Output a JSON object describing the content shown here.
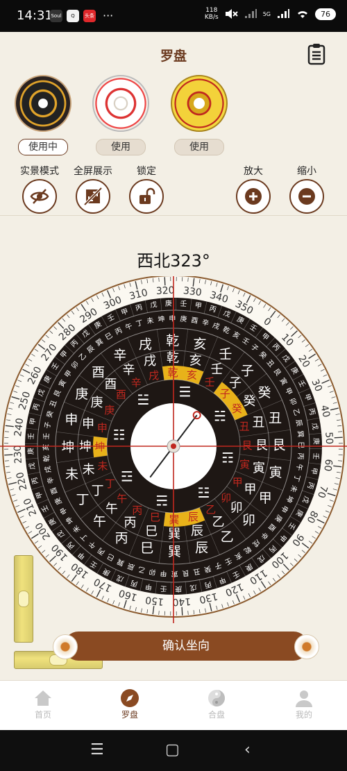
{
  "status_bar": {
    "time": "14:31",
    "app_badges": [
      "Soul",
      "Q",
      "头条"
    ],
    "more": "···",
    "net_speed_value": "118",
    "net_speed_unit": "KB/s",
    "signal": "5G",
    "battery": "76"
  },
  "header": {
    "title": "罗盘"
  },
  "themes": [
    {
      "button": "使用中",
      "active": true
    },
    {
      "button": "使用",
      "active": false
    },
    {
      "button": "使用",
      "active": false
    }
  ],
  "tools": {
    "live_mode": "实景模式",
    "fullscreen": "全屏展示",
    "lock": "锁定",
    "zoom_in": "放大",
    "zoom_out": "缩小"
  },
  "heading": "西北323°",
  "compass": {
    "degree_labels": [
      "0",
      "10",
      "20",
      "30",
      "40",
      "50",
      "60",
      "70",
      "80",
      "90",
      "100",
      "110",
      "120",
      "130",
      "140",
      "150",
      "160",
      "170",
      "180",
      "190",
      "200",
      "210",
      "220",
      "230",
      "240",
      "250",
      "260",
      "270",
      "280",
      "290",
      "300",
      "310",
      "320",
      "330",
      "340",
      "350"
    ],
    "ring_mountains": [
      "子",
      "癸",
      "丑",
      "艮",
      "寅",
      "甲",
      "卯",
      "乙",
      "辰",
      "巽",
      "巳",
      "丙",
      "午",
      "丁",
      "未",
      "坤",
      "申",
      "庚",
      "酉",
      "辛",
      "戌",
      "乾",
      "亥",
      "壬"
    ],
    "ring_outer_stems": [
      "甲",
      "丙",
      "戊",
      "庚",
      "壬"
    ],
    "trigrams": [
      "☵",
      "☶",
      "☳",
      "☴",
      "☲",
      "☷",
      "☱",
      "☰"
    ],
    "highlight_color": "#e8b21a",
    "face_color": "#1e1714",
    "needle_color": "#c0281f"
  },
  "confirm_button": "确认坐向",
  "tabs": [
    {
      "label": "首页",
      "active": false
    },
    {
      "label": "罗盘",
      "active": true
    },
    {
      "label": "合盘",
      "active": false
    },
    {
      "label": "我的",
      "active": false
    }
  ],
  "nav": {
    "menu": "☰",
    "home": "▢",
    "back": "‹"
  }
}
